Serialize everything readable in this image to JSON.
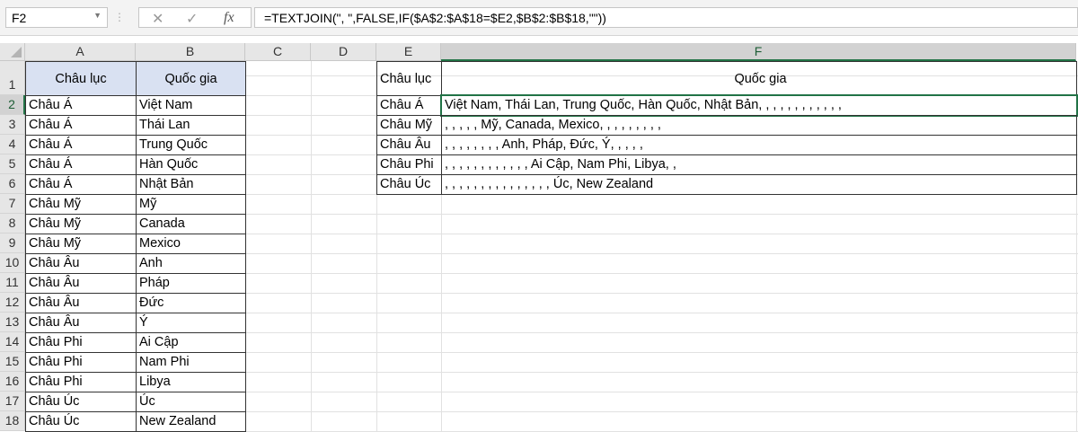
{
  "name_box": "F2",
  "formula": "=TEXTJOIN(\", \",FALSE,IF($A$2:$A$18=$E2,$B$2:$B$18,\"\"))",
  "icons": {
    "cancel": "✕",
    "enter": "✓",
    "fx": "fx"
  },
  "columns": [
    "A",
    "B",
    "C",
    "D",
    "E",
    "F"
  ],
  "rows": [
    "1",
    "2",
    "3",
    "4",
    "5",
    "6",
    "7",
    "8",
    "9",
    "10",
    "11",
    "12",
    "13",
    "14",
    "15",
    "16",
    "17",
    "18"
  ],
  "table1": {
    "headers": [
      "Châu lục",
      "Quốc gia"
    ],
    "data": [
      [
        "Châu Á",
        "Việt Nam"
      ],
      [
        "Châu Á",
        "Thái Lan"
      ],
      [
        "Châu Á",
        "Trung Quốc"
      ],
      [
        "Châu Á",
        "Hàn Quốc"
      ],
      [
        "Châu Á",
        "Nhật Bản"
      ],
      [
        "Châu Mỹ",
        "Mỹ"
      ],
      [
        "Châu Mỹ",
        "Canada"
      ],
      [
        "Châu Mỹ",
        "Mexico"
      ],
      [
        "Châu Âu",
        "Anh"
      ],
      [
        "Châu Âu",
        "Pháp"
      ],
      [
        "Châu Âu",
        "Đức"
      ],
      [
        "Châu Âu",
        "Ý"
      ],
      [
        "Châu Phi",
        "Ai Cập"
      ],
      [
        "Châu Phi",
        "Nam Phi"
      ],
      [
        "Châu Phi",
        "Libya"
      ],
      [
        "Châu Úc",
        "Úc"
      ],
      [
        "Châu Úc",
        "New Zealand"
      ]
    ]
  },
  "table2": {
    "headers": [
      "Châu lục",
      "Quốc gia"
    ],
    "data": [
      [
        "Châu Á",
        "Việt Nam, Thái Lan, Trung Quốc, Hàn Quốc, Nhật Bản, , , , , , , , , , , ,"
      ],
      [
        "Châu Mỹ",
        ", , , , , Mỹ, Canada, Mexico, , , , , , , , ,"
      ],
      [
        "Châu Âu",
        ", , , , , , , , Anh, Pháp, Đức, Ý, , , , ,"
      ],
      [
        "Châu Phi",
        ", , , , , , , , , , , , Ai Cập, Nam Phi, Libya, ,"
      ],
      [
        "Châu Úc",
        ", , , , , , , , , , , , , , , Úc, New Zealand"
      ]
    ]
  }
}
